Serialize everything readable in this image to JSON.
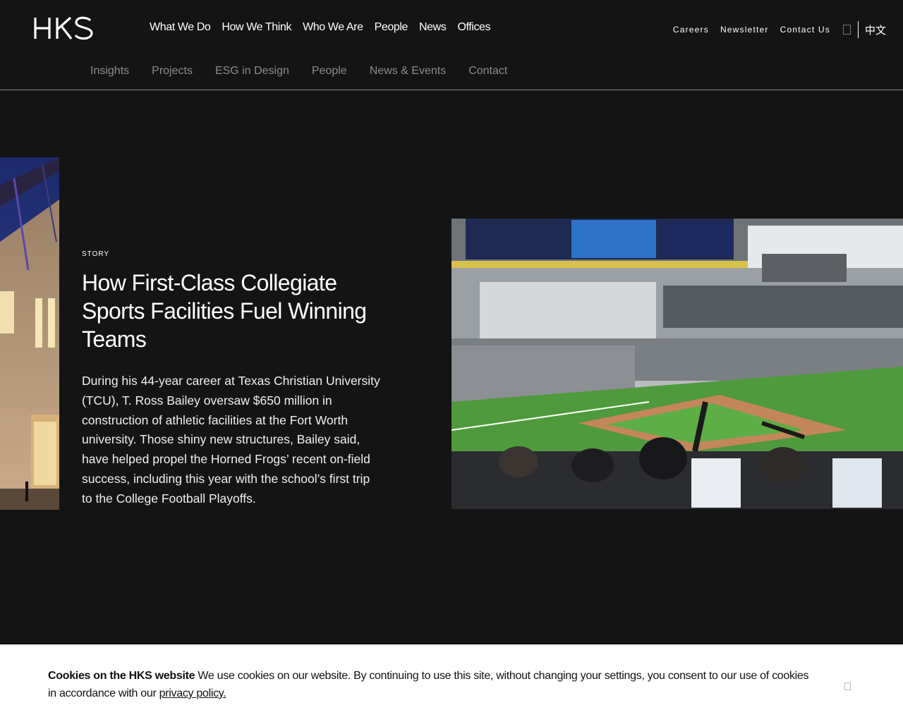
{
  "logo": {
    "text": "HKS"
  },
  "main_nav": [
    {
      "label": "What We Do"
    },
    {
      "label": "How We Think"
    },
    {
      "label": "Who We Are"
    },
    {
      "label": "People"
    },
    {
      "label": "News"
    },
    {
      "label": "Offices"
    }
  ],
  "utility_nav": {
    "careers": "Careers",
    "newsletter": "Newsletter",
    "contact": "Contact Us",
    "language": "中文"
  },
  "sub_nav": [
    {
      "label": "Insights"
    },
    {
      "label": "Projects"
    },
    {
      "label": "ESG in Design"
    },
    {
      "label": "People"
    },
    {
      "label": "News & Events"
    },
    {
      "label": "Contact"
    }
  ],
  "story": {
    "label": "STORY",
    "title": "How First-Class Collegiate Sports Facilities Fuel Winning Teams",
    "body": "During his 44-year career at Texas Christian University (TCU), T. Ross Bailey oversaw $650 million in construction of athletic facilities at the Fort Worth university. Those shiny new structures, Bailey said, have helped propel the Horned Frogs’ recent on-field success, including this year with the school’s first trip to the College Football Playoffs."
  },
  "cookie": {
    "heading": "Cookies on the HKS website",
    "text": " We use cookies on our website. By continuing to use this site, without changing your settings, you consent to our use of cookies in accordance with our ",
    "link": "privacy policy."
  },
  "colors": {
    "background": "#141414",
    "sub_nav_text": "#8b8b8b",
    "banner": "#ffffff"
  }
}
